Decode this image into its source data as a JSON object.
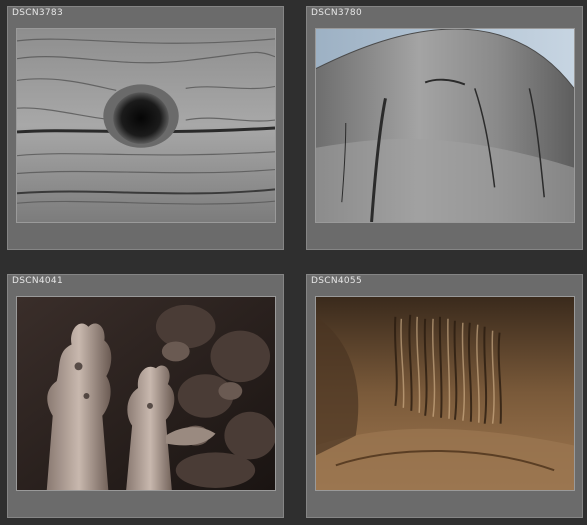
{
  "thumbnails": [
    {
      "name": "DSCN3783",
      "alt": "weathered wood with knot"
    },
    {
      "name": "DSCN3780",
      "alt": "cracked wooden post top"
    },
    {
      "name": "DSCN4041",
      "alt": "eroded rock formations"
    },
    {
      "name": "DSCN4055",
      "alt": "textured weathered wood"
    }
  ]
}
